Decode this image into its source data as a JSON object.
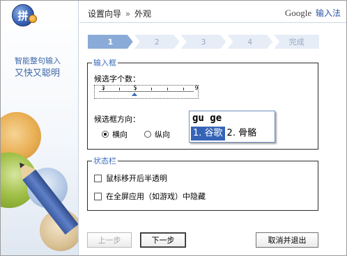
{
  "sidebar": {
    "logo_char": "拼",
    "slogan_line1": "智能整句输入",
    "slogan_line2": "又快又聪明"
  },
  "header": {
    "breadcrumb_main": "设置向导",
    "breadcrumb_sep": "»",
    "breadcrumb_current": "外观",
    "brand_google": "Google",
    "brand_ime": "输入法"
  },
  "steps": [
    {
      "label": "1",
      "active": true
    },
    {
      "label": "2",
      "active": false
    },
    {
      "label": "3",
      "active": false
    },
    {
      "label": "4",
      "active": false
    },
    {
      "label": "完成",
      "active": false
    }
  ],
  "input_box": {
    "title": "输入框",
    "candidate_count_label": "候选字个数：",
    "slider": {
      "min": 3,
      "max": 9,
      "value": 5,
      "tick_labels": [
        "3",
        "5",
        "9"
      ]
    },
    "direction_label": "候选框方向：",
    "direction_options": [
      {
        "label": "横向",
        "checked": true
      },
      {
        "label": "纵向",
        "checked": false
      }
    ],
    "preview": {
      "composition": "gu ge",
      "candidates": [
        "1. 谷歌",
        "2. 骨骼"
      ],
      "selected_index": 0
    }
  },
  "status_bar": {
    "title": "状态栏",
    "options": [
      {
        "label": "鼠标移开后半透明",
        "checked": false
      },
      {
        "label": "在全屏应用（如游戏）中隐藏",
        "checked": false
      }
    ]
  },
  "buttons": {
    "prev": "上一步",
    "next": "下一步",
    "cancel": "取消并退出"
  },
  "colors": {
    "accent": "#3b6cbf",
    "step_active": "#8aabd8",
    "step_inactive": "#e6edf7",
    "candidate_highlight": "#3563b6"
  }
}
